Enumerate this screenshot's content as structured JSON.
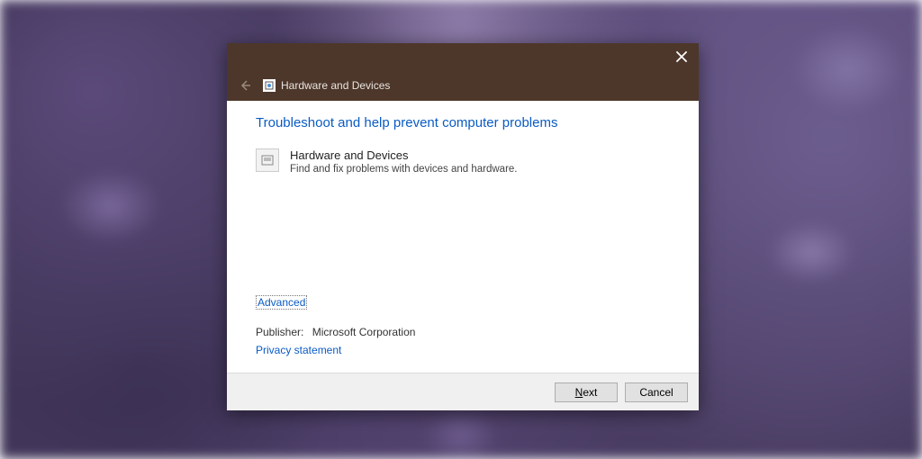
{
  "breadcrumb": {
    "title": "Hardware and Devices"
  },
  "heading": "Troubleshoot and help prevent computer problems",
  "troubleshooter": {
    "title": "Hardware and Devices",
    "description": "Find and fix problems with devices and hardware."
  },
  "links": {
    "advanced": "Advanced",
    "privacy": "Privacy statement"
  },
  "publisher": {
    "label": "Publisher:",
    "value": "Microsoft Corporation"
  },
  "buttons": {
    "next": "Next",
    "cancel": "Cancel"
  }
}
